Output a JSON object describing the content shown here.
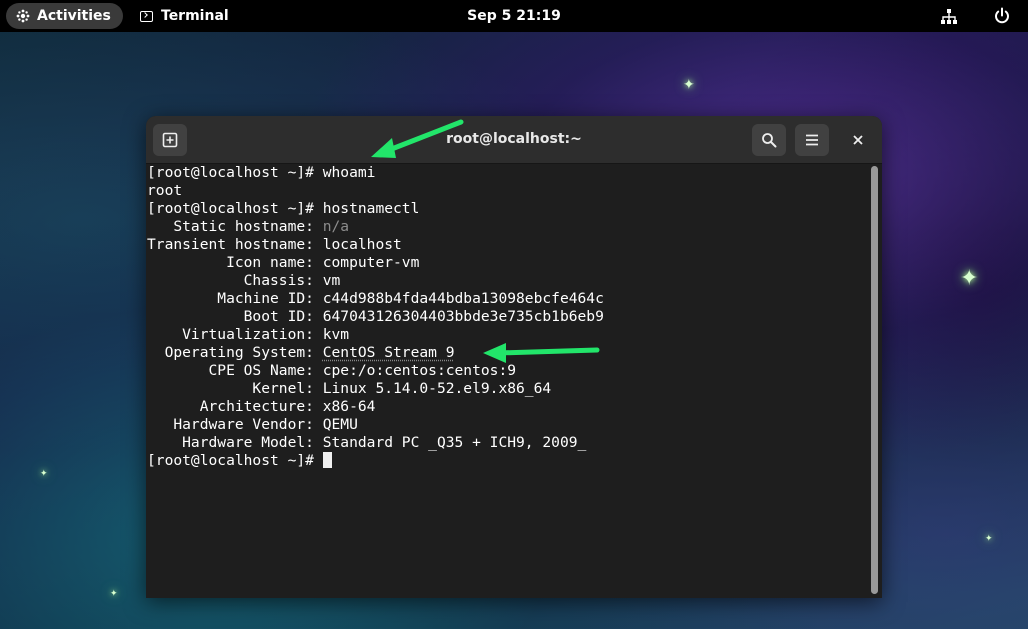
{
  "topbar": {
    "activities_label": "Activities",
    "app_name": "Terminal",
    "clock": "Sep 5  21:19",
    "icons": [
      "activities-icon",
      "terminal-icon",
      "network-icon",
      "power-icon"
    ]
  },
  "window": {
    "title": "root@localhost:~",
    "icons": [
      "new-tab-icon",
      "search-icon",
      "hamburger-menu-icon",
      "close-icon"
    ]
  },
  "terminal": {
    "lines": [
      "[root@localhost ~]# whoami",
      "root",
      "[root@localhost ~]# hostnamectl",
      "   Static hostname: ",
      "Transient hostname: localhost",
      "         Icon name: computer-vm",
      "           Chassis: vm",
      "        Machine ID: c44d988b4fda44bdba13098ebcfe464c",
      "           Boot ID: 647043126304403bbde3e735cb1b6eb9",
      "    Virtualization: kvm",
      "  Operating System: ",
      "       CPE OS Name: cpe:/o:centos:centos:9",
      "            Kernel: Linux 5.14.0-52.el9.x86_64",
      "      Architecture: x86-64",
      "   Hardware Vendor: QEMU",
      "    Hardware Model: Standard PC _Q35 + ICH9, 2009_",
      "[root@localhost ~]# "
    ],
    "static_hostname_value": "n/a",
    "operating_system_value": "CentOS Stream 9"
  },
  "annotations": {
    "arrow_color": "#22e56a"
  }
}
